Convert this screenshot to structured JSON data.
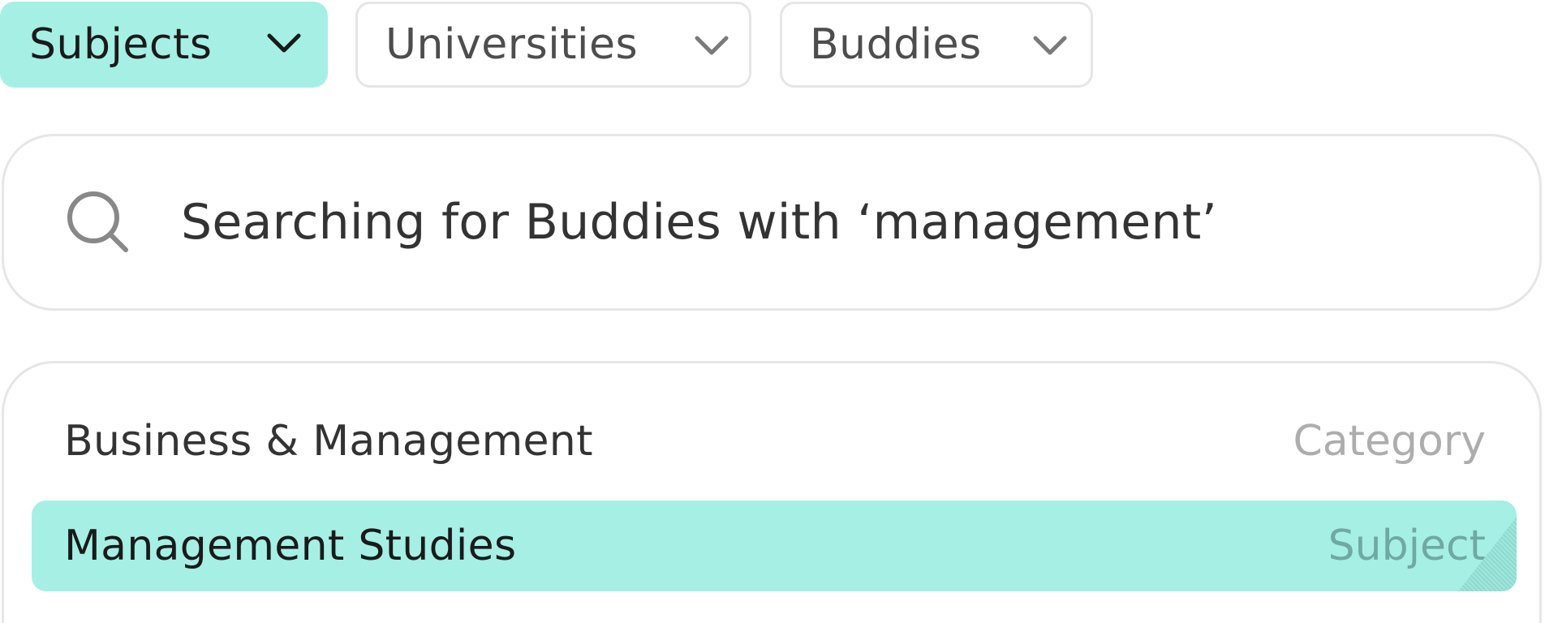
{
  "filters": [
    {
      "label": "Subjects",
      "active": true,
      "icon": "chevron-down-icon"
    },
    {
      "label": "Universities",
      "active": false,
      "icon": "chevron-down-icon"
    },
    {
      "label": "Buddies",
      "active": false,
      "icon": "chevron-down-icon"
    }
  ],
  "search": {
    "icon": "search-icon",
    "text": "Searching for Buddies with ‘management’"
  },
  "results": [
    {
      "name": "Business & Management",
      "type": "Category",
      "highlighted": false
    },
    {
      "name": "Management Studies",
      "type": "Subject",
      "highlighted": true
    }
  ],
  "colors": {
    "accent": "#a6efe5",
    "border": "#e6e6e6",
    "text": "#333333",
    "muted": "#adadad"
  }
}
